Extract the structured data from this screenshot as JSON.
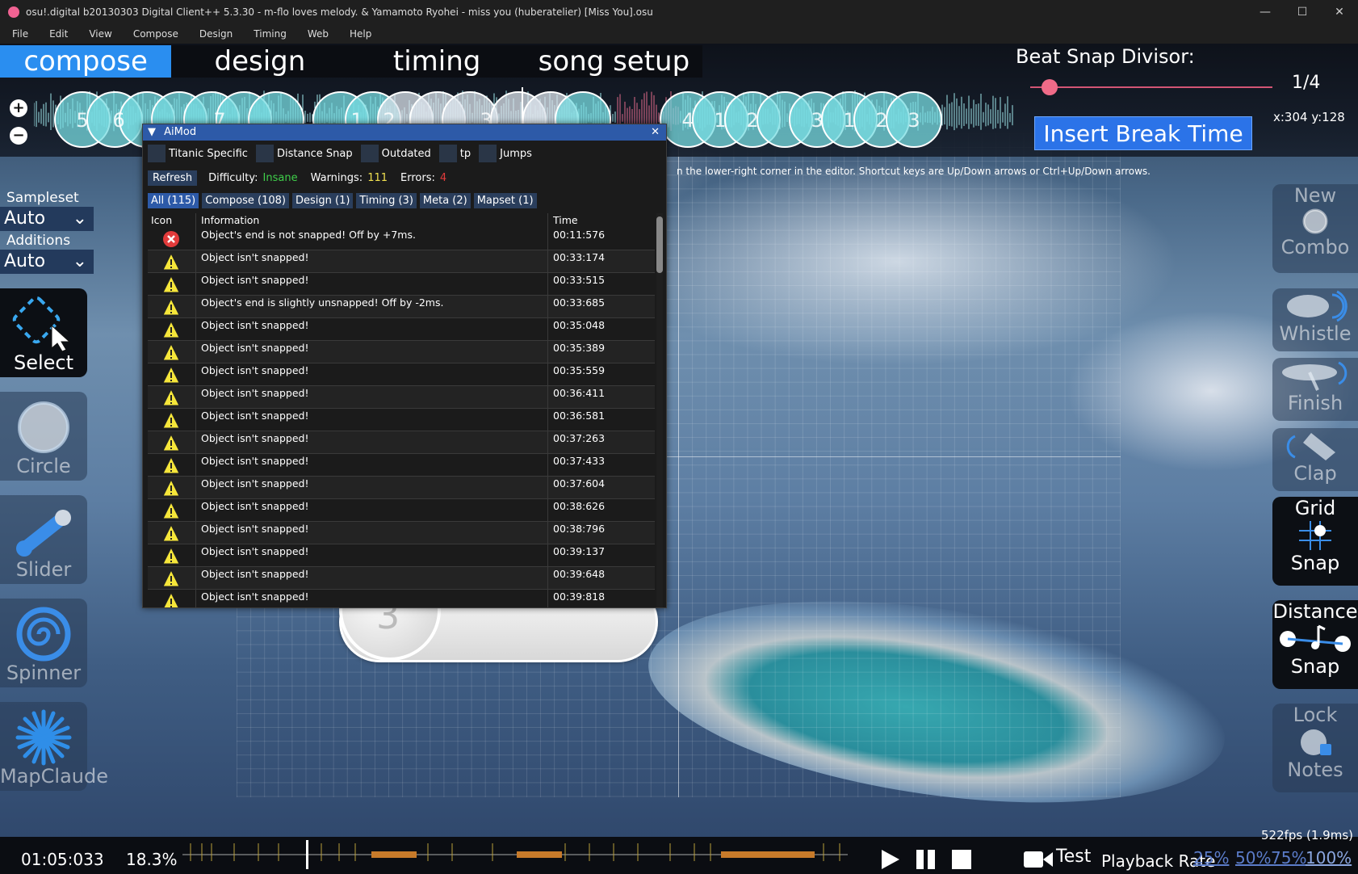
{
  "window": {
    "title": "osu!.digital b20130303 Digital Client++ 5.3.30 - m-flo loves melody. & Yamamoto Ryohei - miss you (huberatelier) [Miss You].osu",
    "min": "—",
    "max": "☐",
    "close": "✕"
  },
  "menu": [
    "File",
    "Edit",
    "View",
    "Compose",
    "Design",
    "Timing",
    "Web",
    "Help"
  ],
  "tabs": [
    "compose",
    "design",
    "timing",
    "song setup"
  ],
  "beat_snap": {
    "label": "Beat Snap Divisor:",
    "value": "1/4",
    "level": 0.08
  },
  "timeline": {
    "zoom_in": "+",
    "zoom_out": "−",
    "numbers": [
      "5",
      "6",
      "7",
      "1",
      "2",
      "3",
      "4",
      "1",
      "2",
      "3",
      "1",
      "2",
      "3"
    ]
  },
  "insert_break": "Insert Break Time",
  "coords": "x:304 y:128",
  "hint": "n the lower-right corner in the editor. Shortcut keys are Up/Down arrows or Ctrl+Up/Down arrows.",
  "left_panel": {
    "sampleset_label": "Sampleset",
    "sampleset_value": "Auto",
    "additions_label": "Additions",
    "additions_value": "Auto",
    "tools": [
      "Select",
      "Circle",
      "Slider",
      "Spinner",
      "MapClaude"
    ]
  },
  "right_panel": {
    "new_combo": [
      "New",
      "Combo"
    ],
    "whistle": "Whistle",
    "finish": "Finish",
    "clap": "Clap",
    "grid_snap": [
      "Grid",
      "Snap"
    ],
    "distance_snap": [
      "Distance",
      "Snap"
    ],
    "lock_notes": [
      "Lock",
      "Notes"
    ]
  },
  "aimod": {
    "title": "AiMod",
    "close": "✕",
    "checks": [
      "Titanic Specific",
      "Distance Snap",
      "Outdated",
      "tp",
      "Jumps"
    ],
    "refresh": "Refresh",
    "difficulty_label": "Difficulty:",
    "difficulty": "Insane",
    "warnings_label": "Warnings:",
    "warnings": "111",
    "errors_label": "Errors:",
    "errors": "4",
    "categories": [
      "All (115)",
      "Compose (108)",
      "Design (1)",
      "Timing (3)",
      "Meta (2)",
      "Mapset (1)"
    ],
    "columns": [
      "Icon",
      "Information",
      "Time"
    ],
    "rows": [
      {
        "icon": "error-icon",
        "info": "Object's end is not snapped! Off by +7ms.",
        "time": "00:11:576"
      },
      {
        "icon": "warning-icon",
        "info": "Object isn't snapped!",
        "time": "00:33:174"
      },
      {
        "icon": "warning-icon",
        "info": "Object isn't snapped!",
        "time": "00:33:515"
      },
      {
        "icon": "warning-icon",
        "info": "Object's end is slightly unsnapped! Off by -2ms.",
        "time": "00:33:685"
      },
      {
        "icon": "warning-icon",
        "info": "Object isn't snapped!",
        "time": "00:35:048"
      },
      {
        "icon": "warning-icon",
        "info": "Object isn't snapped!",
        "time": "00:35:389"
      },
      {
        "icon": "warning-icon",
        "info": "Object isn't snapped!",
        "time": "00:35:559"
      },
      {
        "icon": "warning-icon",
        "info": "Object isn't snapped!",
        "time": "00:36:411"
      },
      {
        "icon": "warning-icon",
        "info": "Object isn't snapped!",
        "time": "00:36:581"
      },
      {
        "icon": "warning-icon",
        "info": "Object isn't snapped!",
        "time": "00:37:263"
      },
      {
        "icon": "warning-icon",
        "info": "Object isn't snapped!",
        "time": "00:37:433"
      },
      {
        "icon": "warning-icon",
        "info": "Object isn't snapped!",
        "time": "00:37:604"
      },
      {
        "icon": "warning-icon",
        "info": "Object isn't snapped!",
        "time": "00:38:626"
      },
      {
        "icon": "warning-icon",
        "info": "Object isn't snapped!",
        "time": "00:38:796"
      },
      {
        "icon": "warning-icon",
        "info": "Object isn't snapped!",
        "time": "00:39:137"
      },
      {
        "icon": "warning-icon",
        "info": "Object isn't snapped!",
        "time": "00:39:648"
      },
      {
        "icon": "warning-icon",
        "info": "Object isn't snapped!",
        "time": "00:39:818"
      }
    ]
  },
  "canvas": {
    "slider_number": "3"
  },
  "bottom": {
    "time": "01:05:033",
    "percent": "18.3%",
    "fps": "522fps (1.9ms)",
    "test": "Test",
    "playback_label": "Playback Rate",
    "rates": [
      "25%",
      "50%",
      "75%",
      "100%"
    ]
  },
  "colors": {
    "accent": "#2a8ef0",
    "difficulty": "#3fcf4a",
    "warnings": "#f0e050",
    "errors": "#e23b3b",
    "knob": "#f06b88"
  }
}
